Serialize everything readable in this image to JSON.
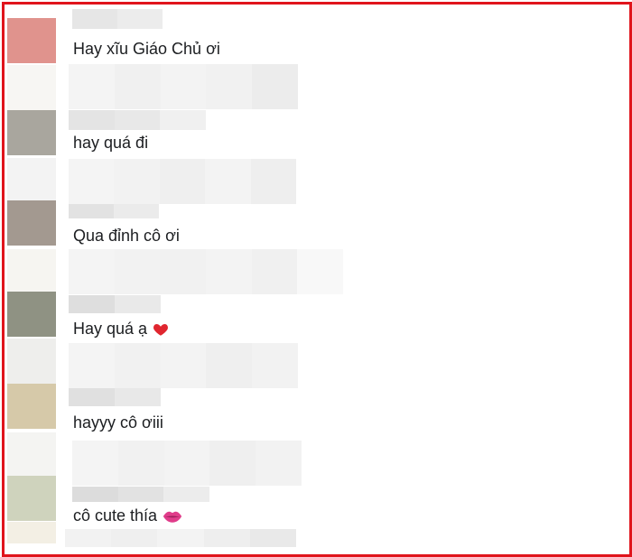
{
  "comments": [
    {
      "text": "Hay xĩu Giáo Chủ ơi",
      "avatar_color": "#e0938d"
    },
    {
      "text": "hay quá đi",
      "avatar_color": "#a9a69e"
    },
    {
      "text": "Qua đỉnh cô ơi",
      "avatar_color": "#a39990"
    },
    {
      "text": "Hay quá ạ",
      "emoji": "heart-icon",
      "emoji_color": "#e0262f",
      "avatar_color": "#8f9283"
    },
    {
      "text": "hayyy cô ơiii",
      "avatar_color": "#d6c9a9"
    },
    {
      "text": "cô cute thía",
      "emoji": "kiss-lips-icon",
      "emoji_color": "#e03c8a",
      "avatar_color": "#cfd3bd"
    }
  ],
  "colors": {
    "frame_border": "#e0141c",
    "text": "#1c1e21",
    "placeholder_light": "#f1f1f1",
    "placeholder_mid": "#e6e6e6"
  }
}
